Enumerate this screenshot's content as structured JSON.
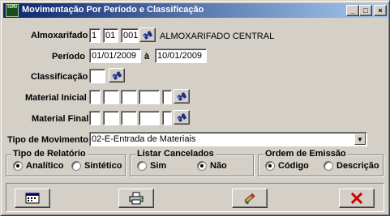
{
  "window": {
    "title": "Movimentação Por Período e Classificação",
    "icon_text": "SGMU",
    "controls": {
      "minimize": "_",
      "maximize": "□",
      "close": "×"
    }
  },
  "form": {
    "almoxarifado": {
      "label": "Almoxarifado",
      "fields": [
        "1",
        "01",
        "001"
      ],
      "description": "ALMOXARIFADO CENTRAL"
    },
    "periodo": {
      "label": "Período",
      "start": "01/01/2009",
      "separator": "à",
      "end": "10/01/2009"
    },
    "classificacao": {
      "label": "Classificação",
      "value": ""
    },
    "material_inicial": {
      "label": "Material Inicial",
      "fields": [
        "",
        "",
        "",
        "",
        ""
      ]
    },
    "material_final": {
      "label": "Material Final",
      "fields": [
        "",
        "",
        "",
        "",
        ""
      ]
    },
    "tipo_movimento": {
      "label": "Tipo de Movimento",
      "selected": "02-E-Entrada de Materiais"
    }
  },
  "groups": {
    "tipo_relatorio": {
      "title": "Tipo de Relatório",
      "options": [
        {
          "label": "Analítico",
          "checked": true
        },
        {
          "label": "Sintético",
          "checked": false
        }
      ]
    },
    "listar_cancelados": {
      "title": "Listar Cancelados",
      "options": [
        {
          "label": "Sim",
          "checked": false
        },
        {
          "label": "Não",
          "checked": true
        }
      ]
    },
    "ordem_emissao": {
      "title": "Ordem de Emissão",
      "options": [
        {
          "label": "Código",
          "checked": true
        },
        {
          "label": "Descrição",
          "checked": false
        }
      ]
    }
  },
  "toolbar": {
    "buttons": [
      {
        "icon": "calendar-icon"
      },
      {
        "icon": "printer-icon"
      },
      {
        "icon": "eraser-icon"
      },
      {
        "icon": "close-icon"
      }
    ]
  },
  "colors": {
    "title_start": "#0a246a",
    "title_end": "#a6caf0",
    "window_bg": "#d4d0c8",
    "close_red": "#cc0000"
  }
}
